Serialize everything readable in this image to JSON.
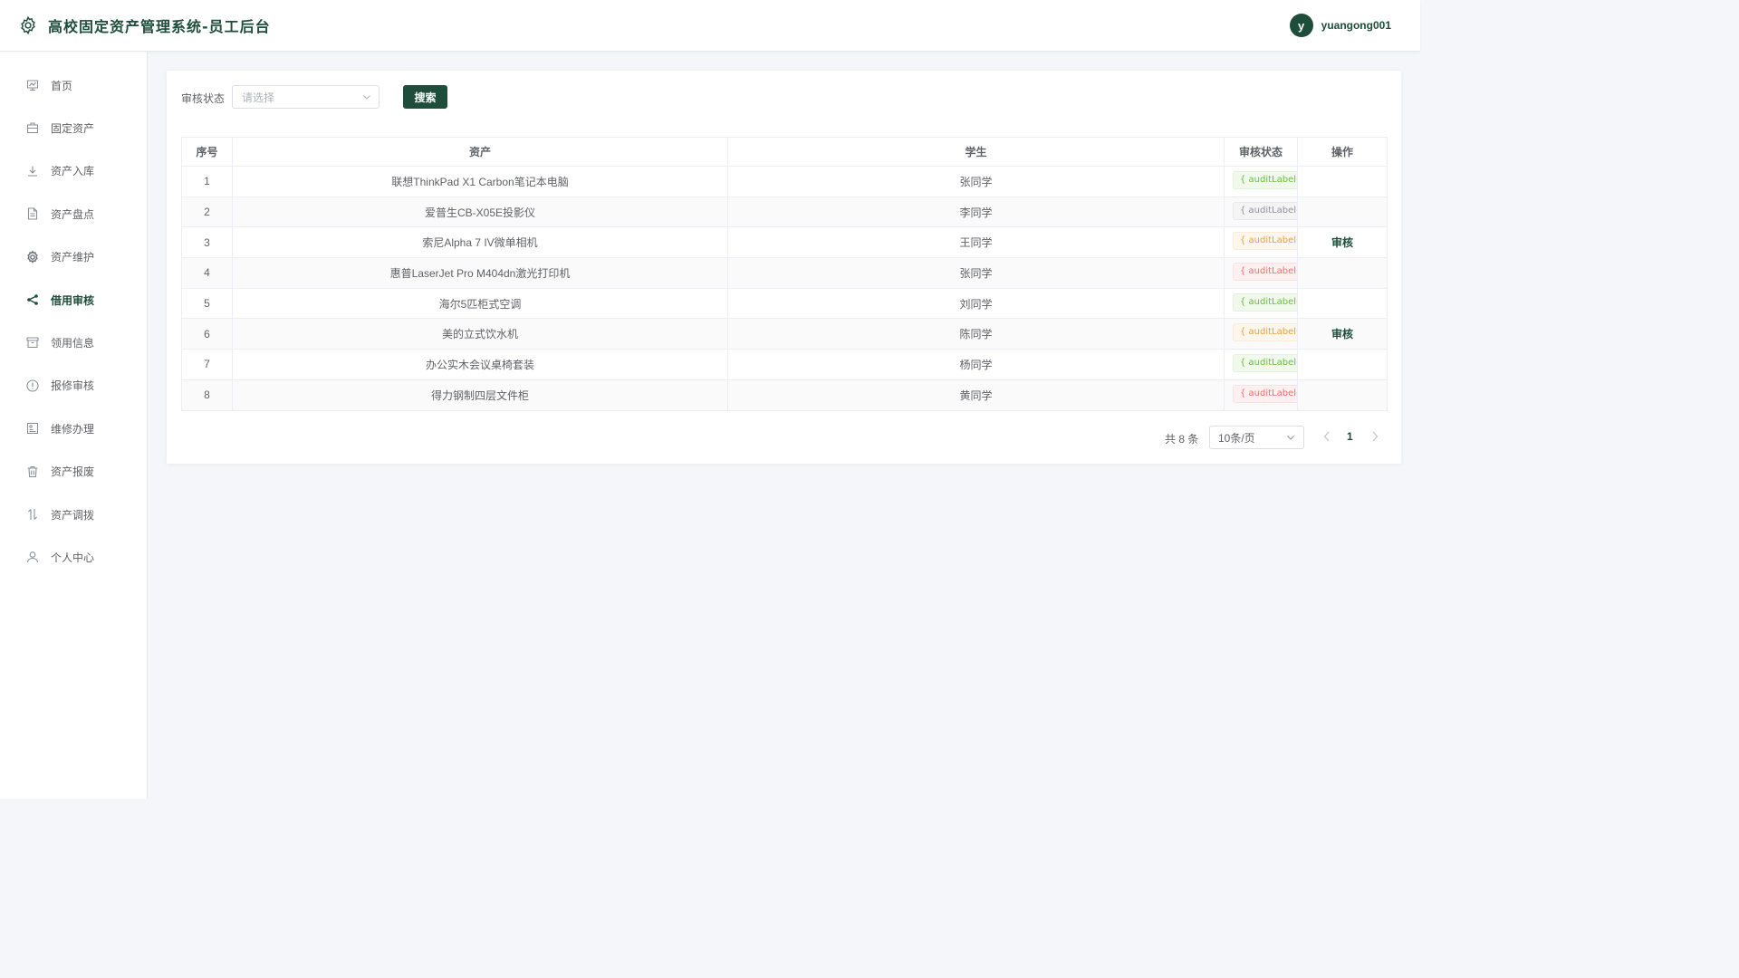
{
  "header": {
    "title": "高校固定资产管理系统-员工后台",
    "avatar_initial": "y",
    "username": "yuangong001",
    "accent_color": "#1e4d3b"
  },
  "sidebar": {
    "items": [
      {
        "label": "首页",
        "icon": "chart-board-icon",
        "active": false
      },
      {
        "label": "固定资产",
        "icon": "briefcase-icon",
        "active": false
      },
      {
        "label": "资产入库",
        "icon": "download-icon",
        "active": false
      },
      {
        "label": "资产盘点",
        "icon": "document-icon",
        "active": false
      },
      {
        "label": "资产维护",
        "icon": "gear-icon",
        "active": false
      },
      {
        "label": "借用审核",
        "icon": "share-icon",
        "active": true
      },
      {
        "label": "领用信息",
        "icon": "box-icon",
        "active": false
      },
      {
        "label": "报修审核",
        "icon": "warning-circle-icon",
        "active": false
      },
      {
        "label": "维修办理",
        "icon": "picture-icon",
        "active": false
      },
      {
        "label": "资产报废",
        "icon": "trash-icon",
        "active": false
      },
      {
        "label": "资产调拨",
        "icon": "transfer-icon",
        "active": false
      },
      {
        "label": "个人中心",
        "icon": "user-icon",
        "active": false
      }
    ]
  },
  "filter": {
    "label": "审核状态",
    "placeholder": "请选择",
    "search_button": "搜索"
  },
  "table": {
    "columns": [
      "序号",
      "资产",
      "学生",
      "审核状态",
      "操作"
    ],
    "rows": [
      {
        "index": "1",
        "asset": "联想ThinkPad X1 Carbon笔记本电脑",
        "student": "张同学",
        "status": "{ auditLabel(ro",
        "status_type": "success",
        "action": ""
      },
      {
        "index": "2",
        "asset": "爱普生CB-X05E投影仪",
        "student": "李同学",
        "status": "{ auditLabel(ro",
        "status_type": "info",
        "action": ""
      },
      {
        "index": "3",
        "asset": "索尼Alpha 7 IV微单相机",
        "student": "王同学",
        "status": "{ auditLabel(ro",
        "status_type": "warning",
        "action": "审核"
      },
      {
        "index": "4",
        "asset": "惠普LaserJet Pro M404dn激光打印机",
        "student": "张同学",
        "status": "{ auditLabel(ro",
        "status_type": "danger",
        "action": ""
      },
      {
        "index": "5",
        "asset": "海尔5匹柜式空调",
        "student": "刘同学",
        "status": "{ auditLabel(ro",
        "status_type": "success",
        "action": ""
      },
      {
        "index": "6",
        "asset": "美的立式饮水机",
        "student": "陈同学",
        "status": "{ auditLabel(ro",
        "status_type": "warning",
        "action": "审核"
      },
      {
        "index": "7",
        "asset": "办公实木会议桌椅套装",
        "student": "杨同学",
        "status": "{ auditLabel(ro",
        "status_type": "success",
        "action": ""
      },
      {
        "index": "8",
        "asset": "得力钢制四层文件柜",
        "student": "黄同学",
        "status": "{ auditLabel(ro",
        "status_type": "danger",
        "action": ""
      }
    ]
  },
  "pagination": {
    "total": "共 8 条",
    "page_size": "10条/页",
    "current_page": "1"
  }
}
